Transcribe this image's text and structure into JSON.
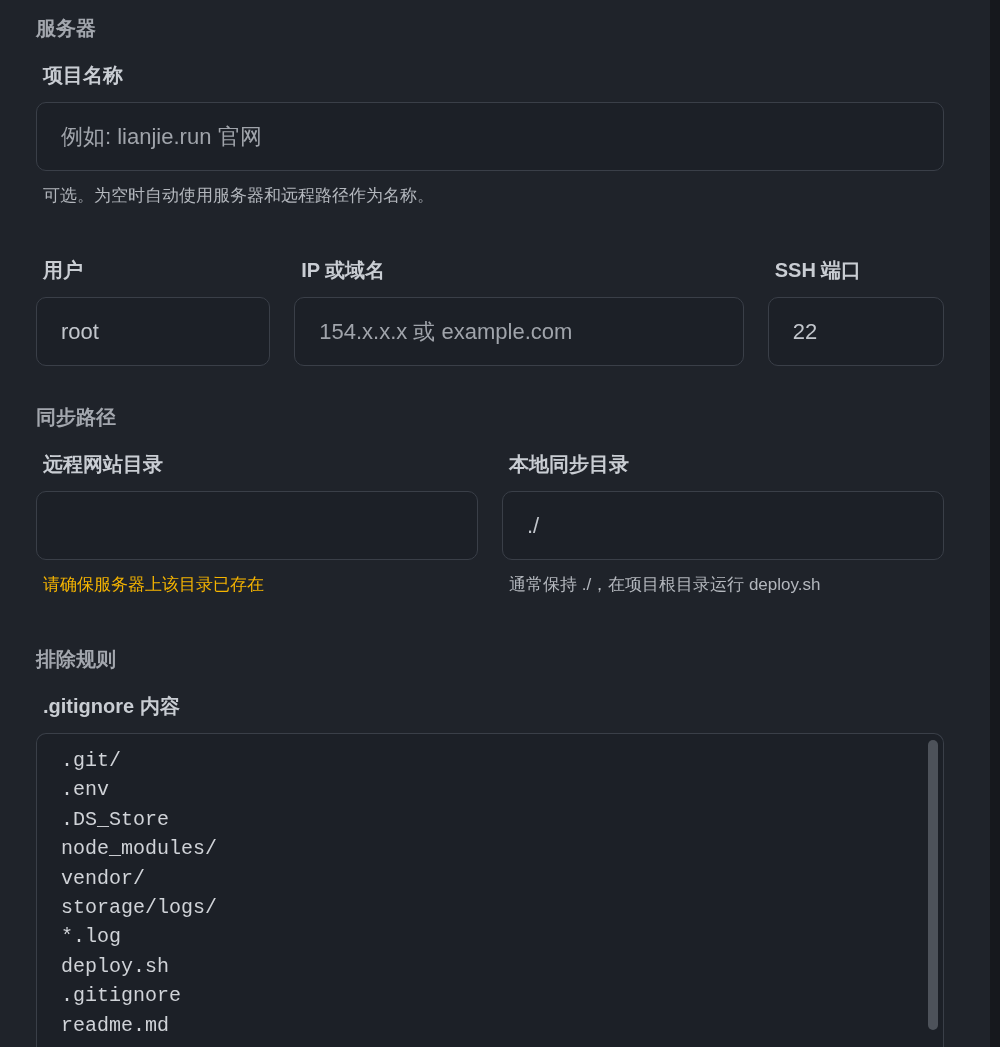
{
  "sections": [
    {
      "title": "服务器",
      "rows": [
        [
          {
            "kind": "input",
            "label": "项目名称",
            "placeholder": "例如: lianjie.run 官网",
            "hint": {
              "kind": "note",
              "text": "可选。为空时自动使用服务器和远程路径作为名称。"
            }
          }
        ],
        [
          {
            "kind": "input",
            "label": "用户",
            "value": "root"
          },
          {
            "kind": "input",
            "label": "IP 或域名",
            "placeholder": "154.x.x.x 或 example.com"
          },
          {
            "kind": "input",
            "label": "SSH 端口",
            "value": "22"
          }
        ]
      ]
    },
    {
      "title": "同步路径",
      "rows": [
        [
          {
            "kind": "input",
            "label": "远程网站目录",
            "hint": {
              "kind": "warning",
              "text": "请确保服务器上该目录已存在"
            }
          },
          {
            "kind": "input",
            "label": "本地同步目录",
            "value": "./",
            "hint": {
              "kind": "note",
              "text": "通常保持 ./，在项目根目录运行 deploy.sh"
            }
          }
        ]
      ]
    },
    {
      "title": "排除规则",
      "rows": [
        [
          {
            "kind": "textarea",
            "label": ".gitignore 内容",
            "lines": [
              ".git/",
              ".env",
              ".DS_Store",
              "node_modules/",
              "vendor/",
              "storage/logs/",
              "*.log",
              "deploy.sh",
              ".gitignore",
              "readme.md"
            ]
          }
        ]
      ]
    }
  ]
}
